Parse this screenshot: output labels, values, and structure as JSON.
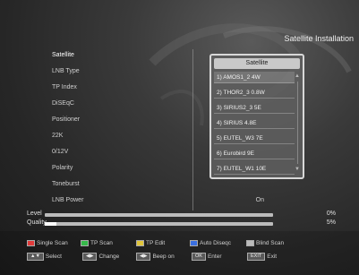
{
  "header": {
    "title": "Satellite Installation"
  },
  "settings": [
    {
      "label": "Satellite",
      "value": ""
    },
    {
      "label": "LNB Type",
      "value": ""
    },
    {
      "label": "TP Index",
      "value": ""
    },
    {
      "label": "DiSEqC",
      "value": ""
    },
    {
      "label": "Positioner",
      "value": ""
    },
    {
      "label": "22K",
      "value": ""
    },
    {
      "label": "0/12V",
      "value": ""
    },
    {
      "label": "Polarity",
      "value": ""
    },
    {
      "label": "Toneburst",
      "value": ""
    },
    {
      "label": "LNB Power",
      "value": "On"
    }
  ],
  "popup": {
    "header": "Satellite",
    "items": [
      "1) AMOS1_2 4W",
      "2) THOR2_3 0.8W",
      "3) SIRIUS2_3 5E",
      "4) SIRIUS 4.8E",
      "5) EUTEL_W3 7E",
      "6) Eurobird 9E",
      "7) EUTEL_W1 10E"
    ]
  },
  "signal": {
    "level": {
      "label": "Level",
      "value": "0%",
      "percent": 0
    },
    "quality": {
      "label": "Quality",
      "value": "5%",
      "percent": 5
    }
  },
  "footer": {
    "color_keys": [
      {
        "label": "Single Scan",
        "color": "#e03a3a"
      },
      {
        "label": "TP Scan",
        "color": "#36b84a"
      },
      {
        "label": "TP Edit",
        "color": "#e0c53a"
      },
      {
        "label": "Auto Diseqc",
        "color": "#3a6fe0"
      },
      {
        "label": "Blind Scan",
        "color": "#bbbbbb"
      }
    ],
    "nav_keys": [
      {
        "key": "▲▼",
        "label": "Select"
      },
      {
        "key": "◀▶",
        "label": "Change"
      },
      {
        "key": "◀▶",
        "label": "Beep on"
      },
      {
        "key": "OK",
        "label": "Enter"
      },
      {
        "key": "EXIT",
        "label": "Exit"
      }
    ]
  },
  "colors": {
    "accent": "#c9c9c9",
    "background": "#2a2a2a"
  }
}
